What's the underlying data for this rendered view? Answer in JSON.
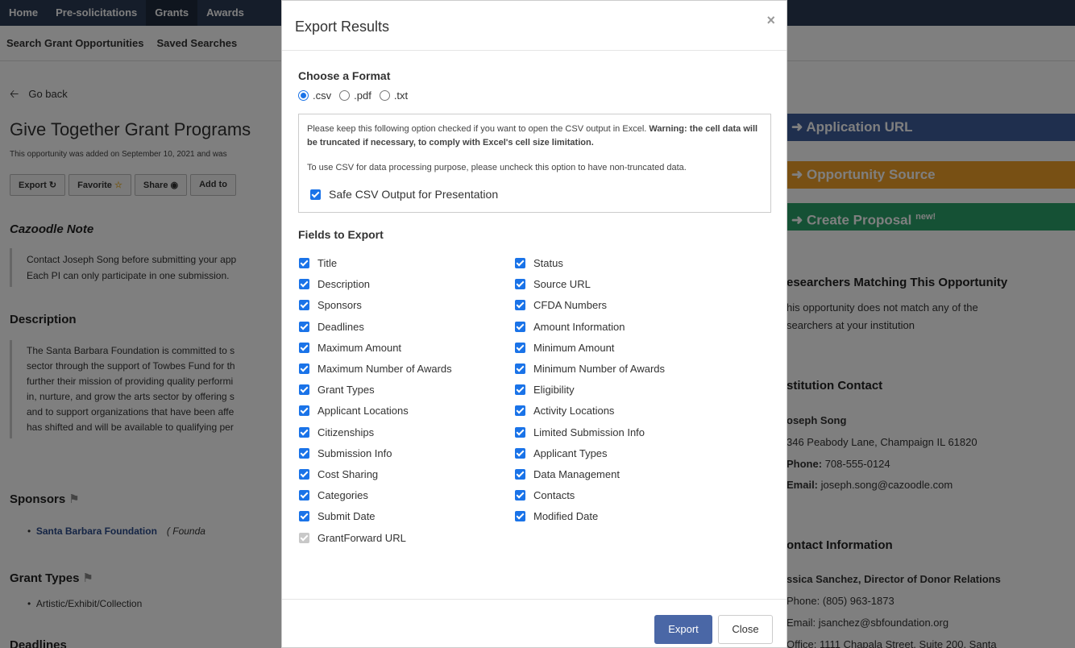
{
  "topnav": [
    "Home",
    "Pre-solicitations",
    "Grants",
    "Awards"
  ],
  "subnav": [
    "Search Grant Opportunities",
    "Saved Searches"
  ],
  "page": {
    "go_back": "Go back",
    "title": "Give Together Grant Programs",
    "added": "This opportunity was added on September 10, 2021 and was",
    "buttons": [
      "Export",
      "Favorite",
      "Share",
      "Add to"
    ],
    "note_heading": "Cazoodle Note",
    "note_lines": [
      "Contact Joseph Song before submitting your app",
      "Each PI can only participate in one submission."
    ],
    "description_heading": "Description",
    "description_lines": [
      "The Santa Barbara Foundation is committed to s",
      "sector through the support of Towbes Fund for th",
      "further their mission of providing quality performi",
      "in, nurture, and grow the arts sector by offering s",
      "and to support organizations that have been affe",
      "has shifted and will be available to qualifying per"
    ],
    "sponsors_heading": "Sponsors",
    "sponsor_link": "Santa Barbara Foundation",
    "sponsor_type": "( Founda",
    "grant_types_heading": "Grant Types",
    "grant_type_item": "Artistic/Exhibit/Collection",
    "deadlines_heading": "Deadlines"
  },
  "right": {
    "application_url": "Application URL",
    "opportunity_source": "Opportunity Source",
    "create_proposal": "Create Proposal",
    "create_proposal_badge": "new!",
    "researchers_heading": "esearchers Matching This Opportunity",
    "researchers_text_1": "his opportunity does not match any of the",
    "researchers_text_2": "searchers at your institution",
    "institution_heading": "stitution Contact",
    "contact_name": "oseph Song",
    "contact_address": "346 Peabody Lane, Champaign IL 61820",
    "contact_phone_label": "Phone:",
    "contact_phone": "708-555-0124",
    "contact_email_label": "Email:",
    "contact_email": "joseph.song@cazoodle.com",
    "contact_info_heading": "ontact Information",
    "ci_name": "ssica Sanchez, Director of Donor Relations",
    "ci_phone": "Phone: (805) 963-1873",
    "ci_email": "Email: jsanchez@sbfoundation.org",
    "ci_office": "Office: 1111 Chapala Street, Suite 200, Santa"
  },
  "modal": {
    "title": "Export Results",
    "close_symbol": "×",
    "format_heading": "Choose a Format",
    "formats": [
      {
        "label": ".csv",
        "selected": true
      },
      {
        "label": ".pdf",
        "selected": false
      },
      {
        "label": ".txt",
        "selected": false
      }
    ],
    "csv_note_1": "Please keep this following option checked if you want to open the CSV output in Excel.",
    "csv_note_warning": "Warning: the cell data will be truncated if necessary, to comply with Excel's cell size limitation.",
    "csv_note_2": "To use CSV for data processing purpose, please uncheck this option to have non-truncated data.",
    "safe_csv_label": "Safe CSV Output for Presentation",
    "fields_heading": "Fields to Export",
    "fields_left": [
      "Title",
      "Description",
      "Sponsors",
      "Deadlines",
      "Maximum Amount",
      "Maximum Number of Awards",
      "Grant Types",
      "Applicant Locations",
      "Citizenships",
      "Submission Info",
      "Cost Sharing",
      "Categories",
      "Submit Date",
      "GrantForward URL"
    ],
    "fields_right": [
      "Status",
      "Source URL",
      "CFDA Numbers",
      "Amount Information",
      "Minimum Amount",
      "Minimum Number of Awards",
      "Eligibility",
      "Activity Locations",
      "Limited Submission Info",
      "Applicant Types",
      "Data Management",
      "Contacts",
      "Modified Date"
    ],
    "export_button": "Export",
    "close_button": "Close"
  }
}
